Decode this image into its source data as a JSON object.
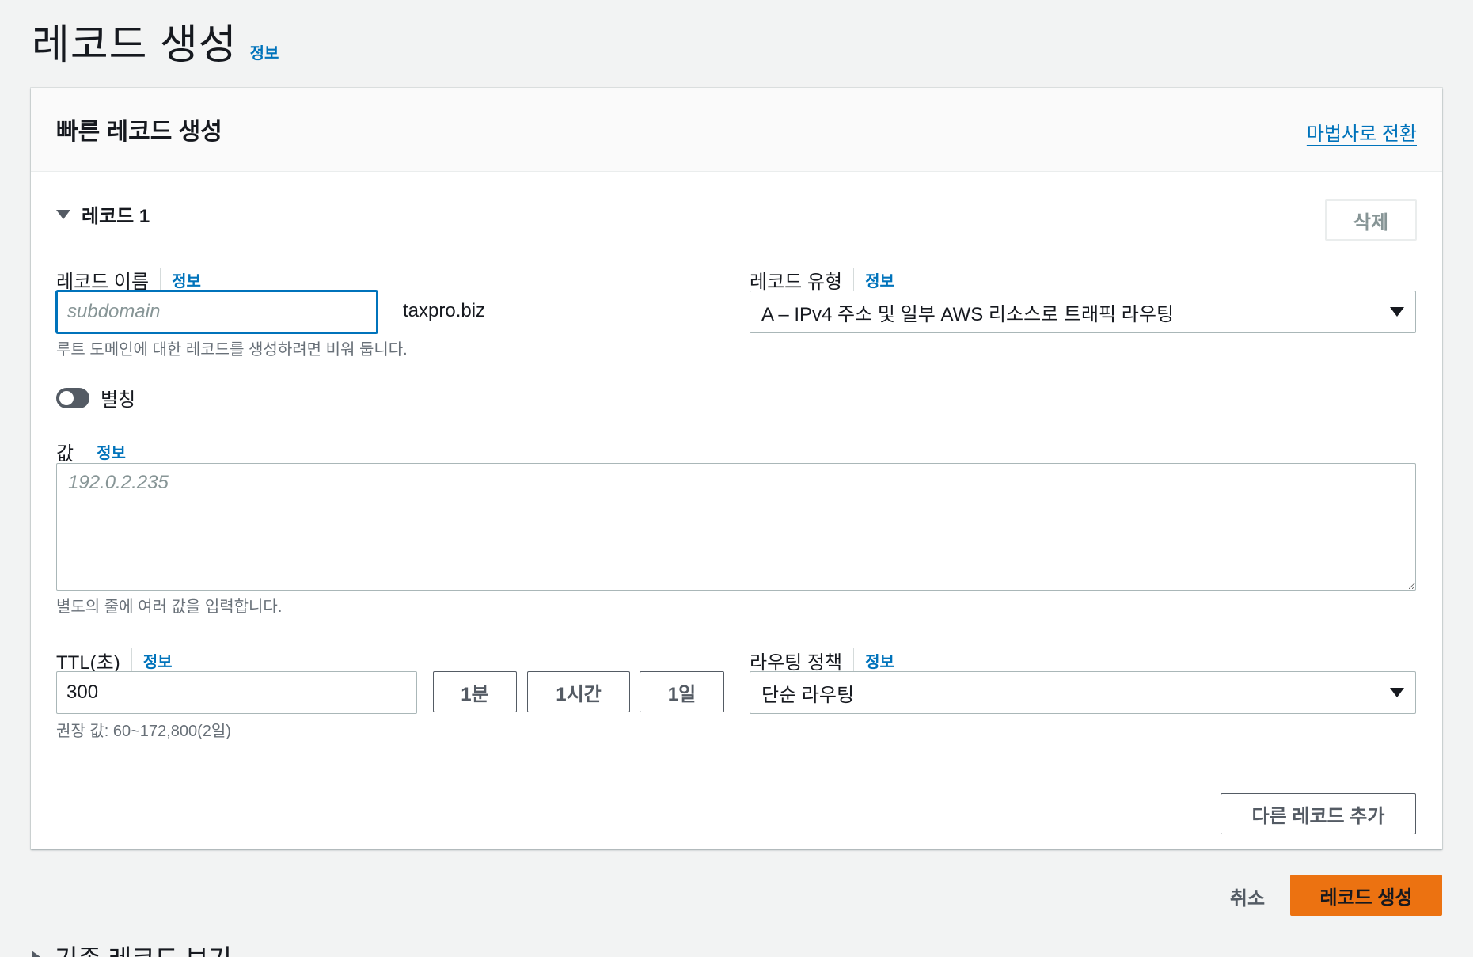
{
  "page": {
    "title": "레코드 생성",
    "info": "정보"
  },
  "card": {
    "title": "빠른 레코드 생성",
    "wizard_link": "마법사로 전환"
  },
  "record": {
    "section_label": "레코드 1",
    "delete_label": "삭제",
    "name": {
      "label": "레코드 이름",
      "info": "정보",
      "value": "",
      "placeholder": "subdomain",
      "suffix": "taxpro.biz",
      "hint": "루트 도메인에 대한 레코드를 생성하려면 비워 둡니다."
    },
    "type": {
      "label": "레코드 유형",
      "info": "정보",
      "selected": "A – IPv4 주소 및 일부 AWS 리소스로 트래픽 라우팅"
    },
    "alias": {
      "label": "별칭",
      "enabled": false
    },
    "value": {
      "label": "값",
      "info": "정보",
      "value": "",
      "placeholder": "192.0.2.235",
      "hint": "별도의 줄에 여러 값을 입력합니다."
    },
    "ttl": {
      "label": "TTL(초)",
      "info": "정보",
      "value": "300",
      "presets": [
        "1분",
        "1시간",
        "1일"
      ],
      "hint": "권장 값: 60~172,800(2일)"
    },
    "routing": {
      "label": "라우팅 정책",
      "info": "정보",
      "selected": "단순 라우팅"
    }
  },
  "add_record_label": "다른 레코드 추가",
  "actions": {
    "cancel": "취소",
    "create": "레코드 생성"
  },
  "existing_records_label": "기존 레코드 보기",
  "colors": {
    "accent": "#0073bb",
    "primary_button": "#ec7211",
    "background": "#f2f3f3"
  }
}
